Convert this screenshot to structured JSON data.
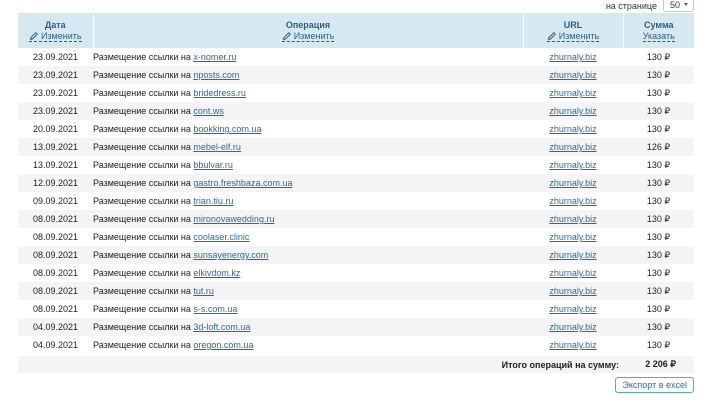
{
  "pagination": {
    "per_page_label": "на странице",
    "per_page_value": "50"
  },
  "columns": {
    "date": {
      "title": "Дата",
      "action": "Изменить",
      "icon": "pencil-icon"
    },
    "operation": {
      "title": "Операция",
      "action": "Изменить",
      "icon": "pencil-icon"
    },
    "url": {
      "title": "URL",
      "action": "Изменить",
      "icon": "pencil-icon"
    },
    "sum": {
      "title": "Сумма",
      "action": "Указать"
    }
  },
  "op_prefix": "Размещение ссылки на ",
  "rows": [
    {
      "date": "23.09.2021",
      "site": "x-nomer.ru",
      "url": "zhurnaly.biz",
      "sum": "130 ₽"
    },
    {
      "date": "23.09.2021",
      "site": "nposts.com",
      "url": "zhurnaly.biz",
      "sum": "130 ₽"
    },
    {
      "date": "23.09.2021",
      "site": "bridedress.ru",
      "url": "zhurnaly.biz",
      "sum": "130 ₽"
    },
    {
      "date": "23.09.2021",
      "site": "cont.ws",
      "url": "zhurnaly.biz",
      "sum": "130 ₽"
    },
    {
      "date": "20.09.2021",
      "site": "bookking.com.ua",
      "url": "zhurnaly.biz",
      "sum": "130 ₽"
    },
    {
      "date": "13.09.2021",
      "site": "mebel-elf.ru",
      "url": "zhurnaly.biz",
      "sum": "126 ₽"
    },
    {
      "date": "13.09.2021",
      "site": "bbulvar.ru",
      "url": "zhurnaly.biz",
      "sum": "130 ₽"
    },
    {
      "date": "12.09.2021",
      "site": "gastro.freshbaza.com.ua",
      "url": "zhurnaly.biz",
      "sum": "130 ₽"
    },
    {
      "date": "09.09.2021",
      "site": "trian.tiu.ru",
      "url": "zhurnaly.biz",
      "sum": "130 ₽"
    },
    {
      "date": "08.09.2021",
      "site": "mironovawedding.ru",
      "url": "zhurnaly.biz",
      "sum": "130 ₽"
    },
    {
      "date": "08.09.2021",
      "site": "coolaser.clinic",
      "url": "zhurnaly.biz",
      "sum": "130 ₽"
    },
    {
      "date": "08.09.2021",
      "site": "sunsayenergy.com",
      "url": "zhurnaly.biz",
      "sum": "130 ₽"
    },
    {
      "date": "08.09.2021",
      "site": "elkivdom.kz",
      "url": "zhurnaly.biz",
      "sum": "130 ₽"
    },
    {
      "date": "08.09.2021",
      "site": "tut.ru",
      "url": "zhurnaly.biz",
      "sum": "130 ₽"
    },
    {
      "date": "08.09.2021",
      "site": "s-s.com.ua",
      "url": "zhurnaly.biz",
      "sum": "130 ₽"
    },
    {
      "date": "04.09.2021",
      "site": "3d-loft.com.ua",
      "url": "zhurnaly.biz",
      "sum": "130 ₽"
    },
    {
      "date": "04.09.2021",
      "site": "oregon.com.ua",
      "url": "zhurnaly.biz",
      "sum": "130 ₽"
    }
  ],
  "total": {
    "label": "Итого операций на сумму:",
    "value": "2 206 ₽"
  },
  "export": {
    "label": "Экспорт в excel"
  },
  "colors": {
    "header_bg": "#d6e9f1",
    "header_text": "#2d5f82",
    "link": "#2a6a9e",
    "row_alt": "#f4f4f4"
  }
}
